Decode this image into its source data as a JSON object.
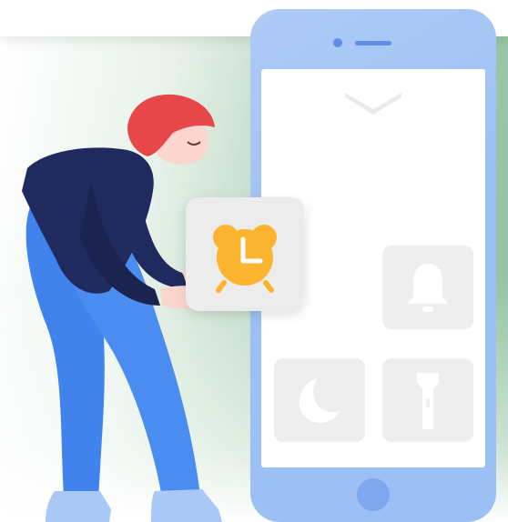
{
  "scene": {
    "colors": {
      "background_green": "#8fc09c",
      "phone_body": "#9dc0f4",
      "phone_accent": "#5f8ee4",
      "screen": "#ffffff",
      "tile": "#eeeeee",
      "tile_icon": "#ffffff",
      "alarm_icon": "#fbb430",
      "hair": "#e8474a",
      "shirt": "#1f2a5e",
      "pants": "#4686ee",
      "skin": "#fbd6cf"
    },
    "phone": {
      "icons": [
        "chevron-down-icon",
        "bell-icon",
        "moon-icon",
        "flashlight-icon"
      ]
    },
    "dragged_tile": {
      "icon": "alarm-clock-icon"
    }
  }
}
